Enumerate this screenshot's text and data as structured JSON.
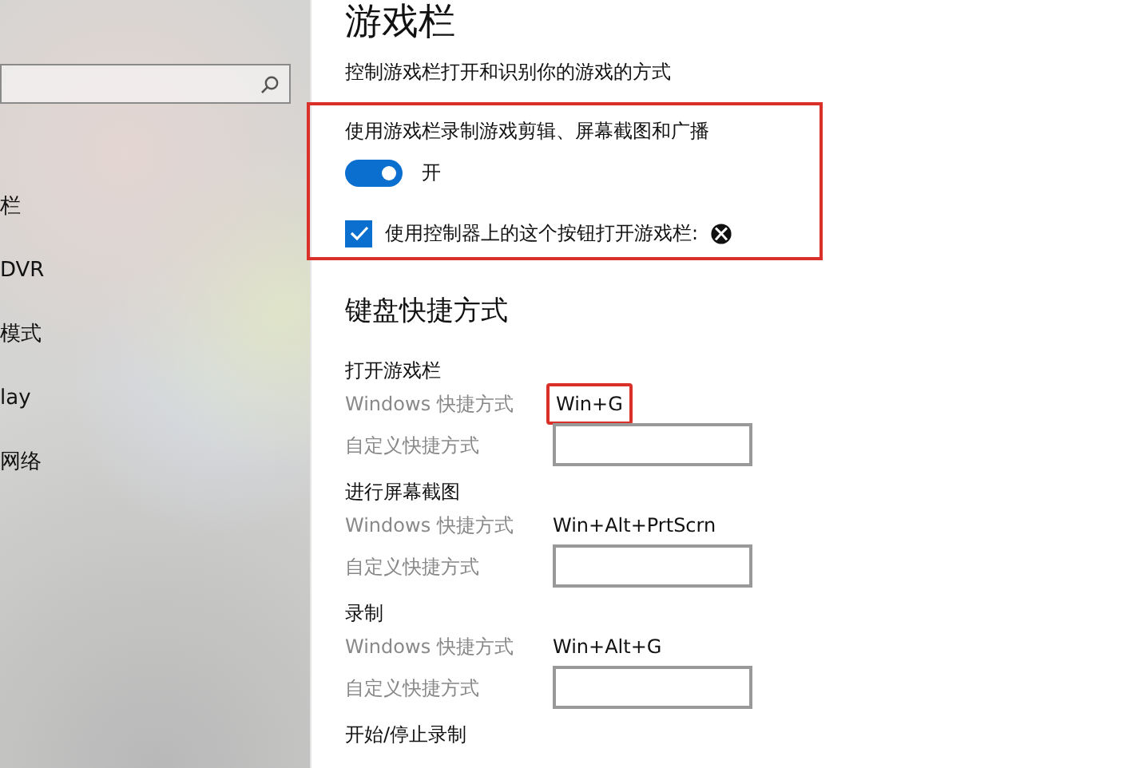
{
  "sidebar": {
    "items": [
      {
        "label": "栏"
      },
      {
        "label": "DVR"
      },
      {
        "label": "模式"
      },
      {
        "label": "lay"
      },
      {
        "label": "网络"
      }
    ]
  },
  "page": {
    "title": "游戏栏",
    "subtitle": "控制游戏栏打开和识别你的游戏的方式",
    "highlighted_section": {
      "label": "使用游戏栏录制游戏剪辑、屏幕截图和广播",
      "toggle": {
        "on": true,
        "state_text": "开"
      },
      "checkbox": {
        "checked": true,
        "label": "使用控制器上的这个按钮打开游戏栏:"
      }
    },
    "shortcuts_heading": "键盘快捷方式",
    "shortcuts": [
      {
        "title": "打开游戏栏",
        "windows_label": "Windows 快捷方式",
        "windows_value": "Win+G",
        "highlighted": true,
        "custom_label": "自定义快捷方式"
      },
      {
        "title": "进行屏幕截图",
        "windows_label": "Windows 快捷方式",
        "windows_value": "Win+Alt+PrtScrn",
        "highlighted": false,
        "custom_label": "自定义快捷方式"
      },
      {
        "title": "录制",
        "windows_label": "Windows 快捷方式",
        "windows_value": "Win+Alt+G",
        "highlighted": false,
        "custom_label": "自定义快捷方式"
      },
      {
        "title": "开始/停止录制"
      }
    ]
  }
}
